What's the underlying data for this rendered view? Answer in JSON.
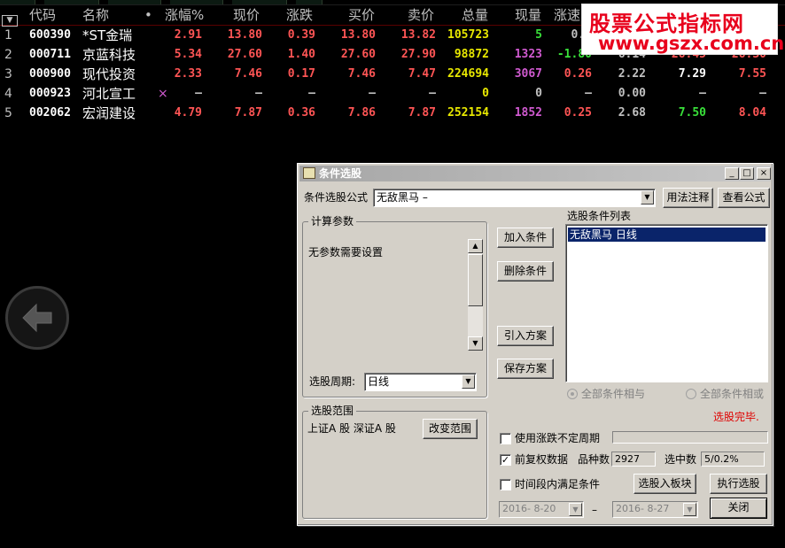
{
  "table": {
    "sort_icon": "triangle-down-icon",
    "columns": [
      "代码",
      "名称",
      "•",
      "涨幅%",
      "现价",
      "涨跌",
      "买价",
      "卖价",
      "总量",
      "现量",
      "涨速"
    ],
    "rows": [
      {
        "idx": "1",
        "code": "600390",
        "name": "*ST金瑞",
        "mark": "",
        "pct": "2.91",
        "price": "13.80",
        "chg": "0.39",
        "bid": "13.80",
        "ask": "13.82",
        "vol": "105723",
        "cur": "5",
        "spd": "0.0",
        "c12": "",
        "c13": "",
        "c14": ""
      },
      {
        "idx": "2",
        "code": "000711",
        "name": "京蓝科技",
        "mark": "",
        "pct": "5.34",
        "price": "27.60",
        "chg": "1.40",
        "bid": "27.60",
        "ask": "27.90",
        "vol": "98872",
        "cur": "1323",
        "spd": "-1.80",
        "c12": "6.14",
        "c13": "26.45",
        "c14": "26.30"
      },
      {
        "idx": "3",
        "code": "000900",
        "name": "现代投资",
        "mark": "",
        "pct": "2.33",
        "price": "7.46",
        "chg": "0.17",
        "bid": "7.46",
        "ask": "7.47",
        "vol": "224694",
        "cur": "3067",
        "spd": "0.26",
        "c12": "2.22",
        "c13": "7.29",
        "c14": "7.55"
      },
      {
        "idx": "4",
        "code": "000923",
        "name": "河北宣工",
        "mark": "×",
        "pct": "–",
        "price": "–",
        "chg": "–",
        "bid": "–",
        "ask": "–",
        "vol": "0",
        "cur": "0",
        "spd": "–",
        "c12": "0.00",
        "c13": "–",
        "c14": "–"
      },
      {
        "idx": "5",
        "code": "002062",
        "name": "宏润建设",
        "mark": "",
        "pct": "4.79",
        "price": "7.87",
        "chg": "0.36",
        "bid": "7.86",
        "ask": "7.87",
        "vol": "252154",
        "cur": "1852",
        "spd": "0.25",
        "c12": "2.68",
        "c13": "7.50",
        "c14": "8.04"
      }
    ]
  },
  "watermark": {
    "line1": "股票公式指标网",
    "line2": "www.gszx.com.cn"
  },
  "back_button": {
    "icon": "arrow-left-icon"
  },
  "dialog": {
    "title": "条件选股",
    "title_icon": "window-icon",
    "win_min": "_",
    "win_max": "□",
    "win_close": "×",
    "formula_label": "条件选股公式",
    "formula_value": "无敌黑马         –",
    "usage_button": "用法注释",
    "view_formula_button": "查看公式",
    "params_group": "计算参数",
    "params_text": "无参数需要设置",
    "period_label": "选股周期:",
    "period_value": "日线",
    "add_condition": "加入条件",
    "delete_condition": "删除条件",
    "import_plan": "引入方案",
    "save_plan": "保存方案",
    "condition_list_label": "选股条件列表",
    "condition_items": [
      "无敌黑马   日线"
    ],
    "radio_and": "全部条件相与",
    "radio_or": "全部条件相或",
    "status": "选股完毕.",
    "range_group": "选股范围",
    "range_text": "上证A 股  深证A 股",
    "change_range": "改变范围",
    "use_variable_period": "使用涨跌不定周期",
    "forward_adjust": "前复权数据",
    "forward_adjust_checked": "✓",
    "stock_count_label": "品种数",
    "stock_count": "2927",
    "selected_count_label": "选中数",
    "selected_count": "5/0.2%",
    "time_range_condition": "时间段内满足条件",
    "to_block_button": "选股入板块",
    "execute_button": "执行选股",
    "close_button": "关闭",
    "date_from": "2016- 8-20",
    "date_sep": "–",
    "date_to": "2016- 8-27"
  }
}
